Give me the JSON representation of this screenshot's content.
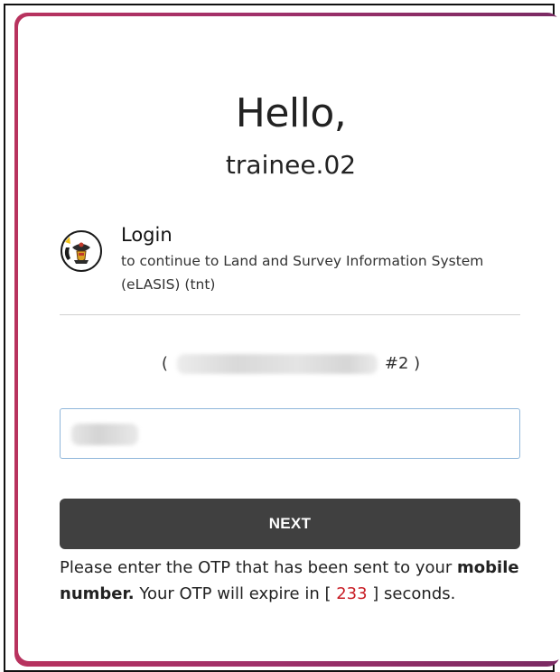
{
  "header": {
    "greeting": "Hello,",
    "username": "trainee.02"
  },
  "app": {
    "icon": "state-crest-icon",
    "login_title": "Login",
    "login_subtitle": "to continue to Land and Survey Information System (eLASIS) (tnt)"
  },
  "delivery": {
    "open_paren": "(",
    "suffix": "#2 )"
  },
  "otp": {
    "placeholder": ""
  },
  "actions": {
    "next_label": "NEXT"
  },
  "hint": {
    "part1": "Please enter the OTP that has been sent to your ",
    "bold1": "mobile number.",
    "part2": " Your OTP will expire in [ ",
    "countdown": "233",
    "part3": " ] seconds."
  },
  "colors": {
    "button_bg": "#404040",
    "input_border": "#8fb6da",
    "countdown": "#c81d25",
    "backdrop_start": "#b8325e",
    "backdrop_end": "#7a2a63"
  }
}
